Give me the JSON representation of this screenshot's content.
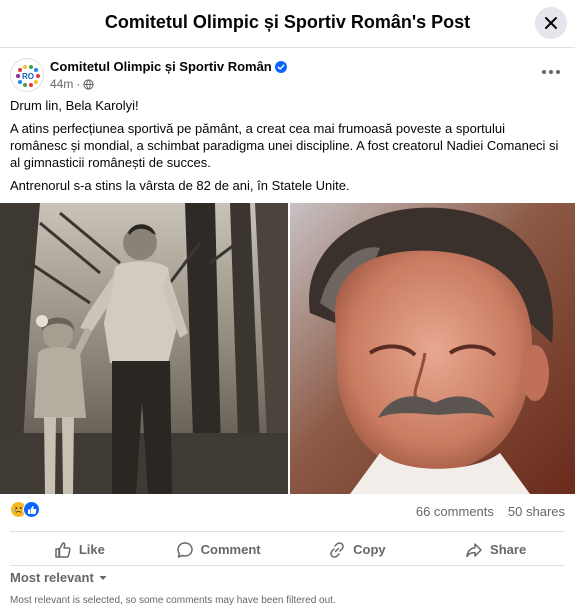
{
  "dialog": {
    "title": "Comitetul Olimpic și Sportiv Român's Post",
    "close_icon": "close-icon"
  },
  "post": {
    "page_name": "Comitetul Olimpic și Sportiv Român",
    "verified_icon": "verified-badge-icon",
    "time": "44m",
    "audience_icon": "globe-icon",
    "more_icon": "more-horizontal-icon",
    "paragraphs": [
      "Drum lin, Bela Karolyi!",
      "A atins perfecțiunea sportivă pe pământ,  a creat cea mai frumoasă poveste a sportului românesc și mondial, a schimbat paradigma unei discipline. A fost creatorul Nadiei Comaneci si al gimnasticii românești de succes.",
      "Antrenorul s-a stins la vârsta de 82 de ani, în Statele Unite."
    ],
    "photos": [
      {
        "description_icon": "black-and-white-photo"
      },
      {
        "description_icon": "portrait-photo"
      }
    ]
  },
  "stats": {
    "reactions": [
      "sad-reaction-icon",
      "like-reaction-icon"
    ],
    "comments": "66 comments",
    "shares": "50 shares"
  },
  "actions": {
    "like": "Like",
    "comment": "Comment",
    "copy": "Copy",
    "share": "Share"
  },
  "comments": {
    "filter_label": "Most relevant",
    "filter_note": "Most relevant is selected, so some comments may have been filtered out."
  },
  "colors": {
    "text_primary": "#050505",
    "text_secondary": "#65676b",
    "verified_blue": "#0866ff",
    "close_bg": "#e4e6eb",
    "divider": "#dcdfe3"
  }
}
